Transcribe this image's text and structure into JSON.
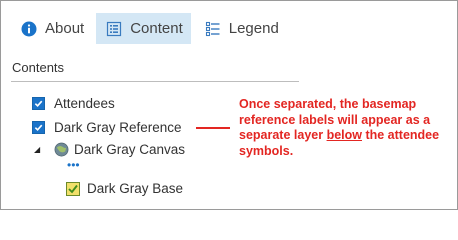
{
  "tabs": [
    {
      "label": "About",
      "icon": "info-icon"
    },
    {
      "label": "Content",
      "icon": "content-list-icon",
      "active": true
    },
    {
      "label": "Legend",
      "icon": "legend-icon"
    }
  ],
  "contents": {
    "title": "Contents",
    "layers": [
      {
        "label": "Attendees",
        "checked": true
      },
      {
        "label": "Dark Gray Reference",
        "checked": true
      },
      {
        "label": "Dark Gray Canvas",
        "icon": "basemap-globe-icon",
        "expanded": true
      },
      {
        "label": "Dark Gray Base",
        "icon": "layer-visible-icon"
      }
    ],
    "more": "•••"
  },
  "annotation": {
    "before": "Once separated, the basemap reference labels will appear as a separate layer ",
    "emphasis": "below",
    "after": " the attendee symbols."
  },
  "colors": {
    "accent": "#1a73c9",
    "active_tab": "#d4e7f5",
    "annotation": "#e32622"
  }
}
